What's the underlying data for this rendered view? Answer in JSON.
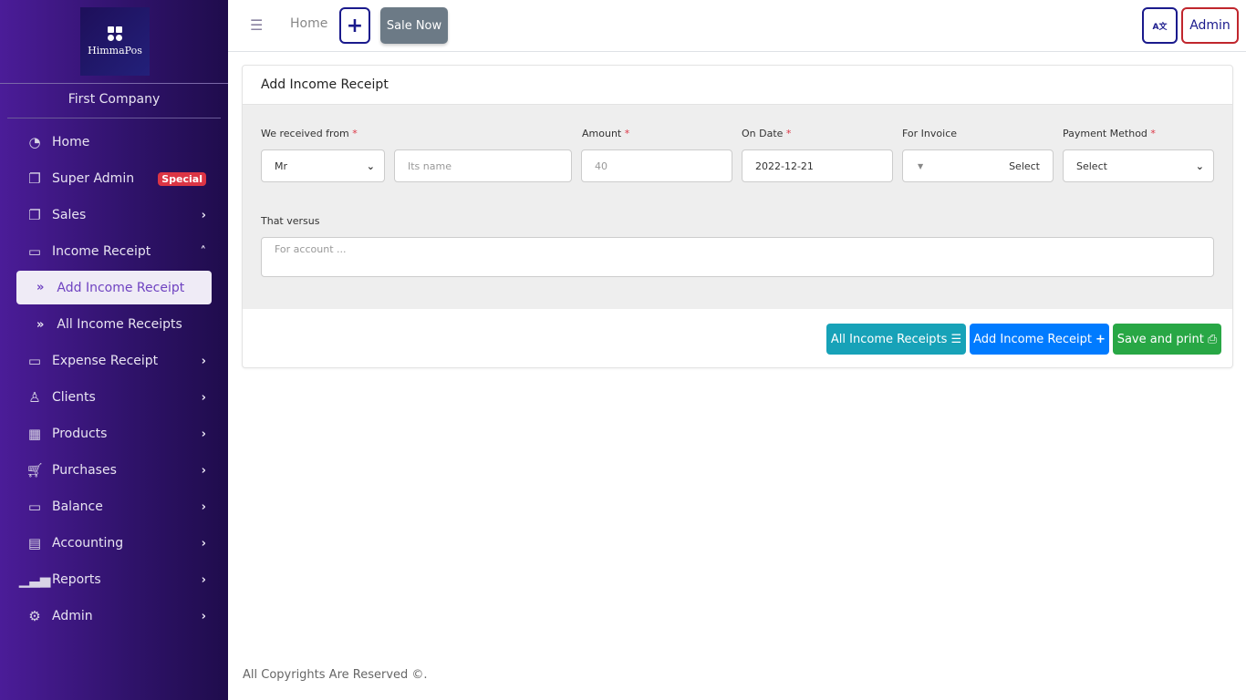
{
  "sidebar": {
    "logo_text": "HimmaPos",
    "company": "First Company",
    "items": [
      {
        "label": "Home",
        "icon": "dashboard-icon"
      },
      {
        "label": "Super Admin",
        "icon": "copy-icon",
        "badge": "Special"
      },
      {
        "label": "Sales",
        "icon": "copy-icon"
      },
      {
        "label": "Income Receipt",
        "icon": "money-icon"
      },
      {
        "label": "Expense Receipt",
        "icon": "money-icon"
      },
      {
        "label": "Clients",
        "icon": "user-icon"
      },
      {
        "label": "Products",
        "icon": "grid-icon"
      },
      {
        "label": "Purchases",
        "icon": "cart-icon"
      },
      {
        "label": "Balance",
        "icon": "money-icon"
      },
      {
        "label": "Accounting",
        "icon": "calculator-icon"
      },
      {
        "label": "Reports",
        "icon": "chart-icon"
      },
      {
        "label": "Admin",
        "icon": "gear-icon"
      }
    ],
    "sub_items": [
      "Add Income Receipt",
      "All Income Receipts"
    ]
  },
  "topbar": {
    "home": "Home",
    "plus": "+",
    "sale_now": "Sale Now",
    "lang": "A文",
    "admin": "Admin"
  },
  "form": {
    "title": "Add Income Receipt",
    "received_from_label": "We received from",
    "title_value": "Mr",
    "name_placeholder": "Its name",
    "amount_label": "Amount",
    "amount_placeholder": "40",
    "date_label": "On Date",
    "date_value": "2022-12-21",
    "invoice_label": "For Invoice",
    "invoice_value": "Select",
    "payment_label": "Payment Method",
    "payment_value": "Select",
    "versus_label": "That versus",
    "versus_placeholder": "For account ...",
    "req": "*"
  },
  "buttons": {
    "all": "All Income Receipts",
    "add": "Add Income Receipt",
    "save": "Save and print"
  },
  "footer": "All Copyrights Are Reserved ©.",
  "colors": {
    "info": "#17a2b8",
    "primary": "#007bff",
    "success": "#28a745",
    "danger": "#dc3545"
  }
}
